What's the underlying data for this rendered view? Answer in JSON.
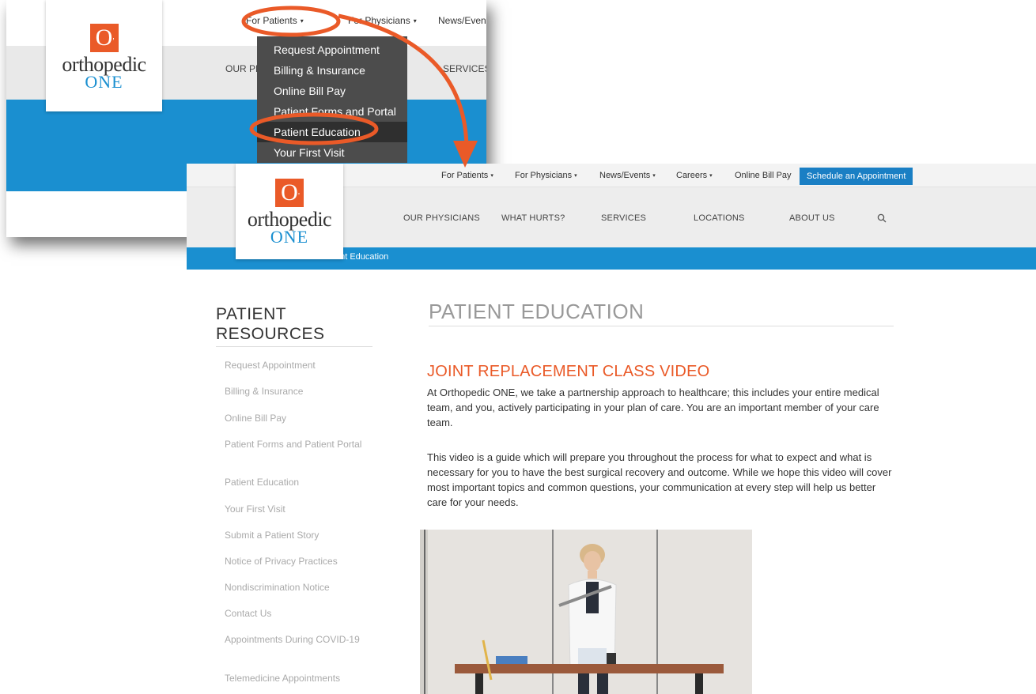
{
  "back": {
    "top_links": [
      {
        "label": "For Patients",
        "caret": "▾"
      },
      {
        "label": "For Physicians",
        "caret": "▾"
      },
      {
        "label": "News/Even"
      }
    ],
    "nav_links": [
      "OUR PH",
      "SERVICES"
    ],
    "logo": {
      "mark": "O",
      "word": "orthopedic",
      "one": "ONE"
    },
    "dropdown": [
      "Request Appointment",
      "Billing & Insurance",
      "Online Bill Pay",
      "Patient Forms and Portal",
      "Patient Education",
      "Your First Visit"
    ]
  },
  "front": {
    "top_links": [
      {
        "label": "For Patients",
        "caret": "▾"
      },
      {
        "label": "For Physicians",
        "caret": "▾"
      },
      {
        "label": "News/Events",
        "caret": "▾"
      },
      {
        "label": "Careers",
        "caret": "▾"
      },
      {
        "label": "Online Bill Pay"
      }
    ],
    "schedule_button": "Schedule an Appointment",
    "logo": {
      "mark": "O",
      "word": "orthopedic",
      "one": "ONE"
    },
    "nav_links": [
      "OUR PHYSICIANS",
      "WHAT HURTS?",
      "SERVICES",
      "LOCATIONS",
      "ABOUT US"
    ],
    "breadcrumb": "ent Education",
    "sidebar": {
      "title_line1": "PATIENT",
      "title_line2": "RESOURCES",
      "items": [
        "Request Appointment",
        "Billing & Insurance",
        "Online Bill Pay",
        "Patient Forms and Patient Portal",
        "Patient Education",
        "Your First Visit",
        "Submit a Patient Story",
        "Notice of Privacy Practices",
        "Nondiscrimination Notice",
        "Contact Us",
        "Appointments During COVID-19",
        "Telemedicine Appointments"
      ]
    },
    "main": {
      "title": "PATIENT EDUCATION",
      "heading": "JOINT REPLACEMENT CLASS VIDEO",
      "paragraph1": "At Orthopedic ONE, we take a partnership approach to healthcare; this includes your entire medical team, and you, actively participating in your plan of care. You are an important member of your care team.",
      "paragraph2": "This video is a guide which will prepare you throughout the process for what to expect and what is necessary for you to have the best surgical recovery and outcome. While we hope this video will cover most important topics and common questions, your communication at every step will help us better care for your needs."
    }
  },
  "colors": {
    "accent_orange": "#ea5a28",
    "brand_blue": "#1a8fd0",
    "button_blue": "#1a7fc4"
  }
}
